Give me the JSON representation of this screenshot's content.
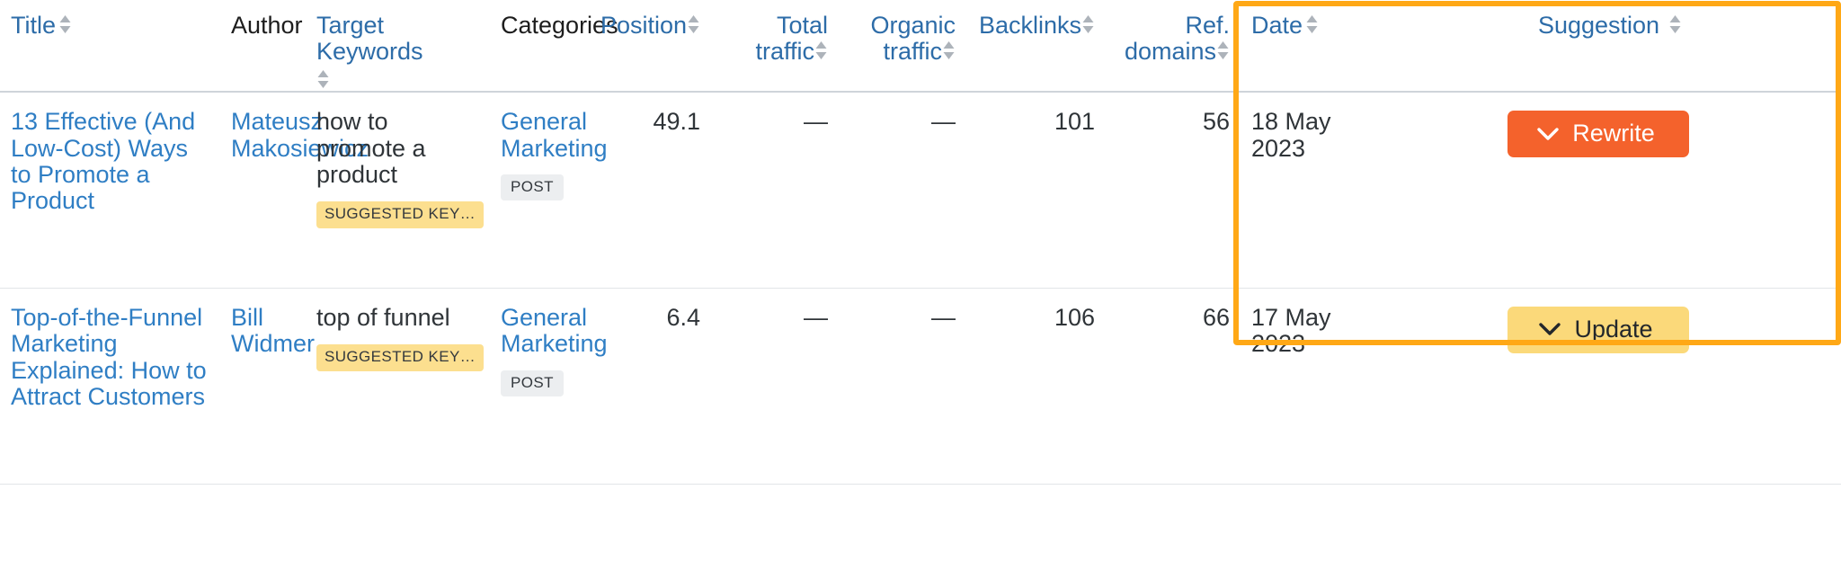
{
  "table": {
    "columns": [
      {
        "id": "title",
        "label": "Title",
        "sortable": true,
        "align": "left",
        "link_style": true
      },
      {
        "id": "author",
        "label": "Author",
        "sortable": false,
        "align": "left",
        "link_style": false
      },
      {
        "id": "target_keywords",
        "label": "Target Keywords",
        "sortable": true,
        "align": "left",
        "link_style": true
      },
      {
        "id": "categories",
        "label": "Categories",
        "sortable": false,
        "align": "left",
        "link_style": false
      },
      {
        "id": "position",
        "label": "Position",
        "sortable": true,
        "align": "right",
        "link_style": true
      },
      {
        "id": "total_traffic",
        "label": "Total traffic",
        "sortable": true,
        "align": "right",
        "link_style": true
      },
      {
        "id": "organic_traffic",
        "label": "Organic traffic",
        "sortable": true,
        "align": "right",
        "link_style": true
      },
      {
        "id": "backlinks",
        "label": "Backlinks",
        "sortable": true,
        "align": "right",
        "link_style": true
      },
      {
        "id": "ref_domains",
        "label": "Ref. domains",
        "sortable": true,
        "align": "right",
        "link_style": true
      },
      {
        "id": "date",
        "label": "Date",
        "sortable": true,
        "align": "left",
        "link_style": true
      },
      {
        "id": "suggestion",
        "label": "Suggestion",
        "sortable": true,
        "align": "center",
        "link_style": true
      }
    ],
    "rows": [
      {
        "title": "13 Effective (And Low-Cost) Ways to Promote a Product",
        "author": "Mateusz Makosiewicz",
        "keyword": "how to promote a product",
        "keyword_badge": "SUGGESTED KEY…",
        "category": "General Marketing",
        "category_badge": "POST",
        "position": "49.1",
        "total_traffic": "—",
        "organic_traffic": "—",
        "backlinks": "101",
        "ref_domains": "56",
        "date": "18 May 2023",
        "suggestion_label": "Rewrite",
        "suggestion_type": "rewrite"
      },
      {
        "title": "Top-of-the-Funnel Marketing Explained: How to Attract Customers",
        "author": "Bill Widmer",
        "keyword": "top of funnel",
        "keyword_badge": "SUGGESTED KEY…",
        "category": "General Marketing",
        "category_badge": "POST",
        "position": "6.4",
        "total_traffic": "—",
        "organic_traffic": "—",
        "backlinks": "106",
        "ref_domains": "66",
        "date": "17 May 2023",
        "suggestion_label": "Update",
        "suggestion_type": "update"
      }
    ]
  },
  "icons": {
    "sort": "sort-arrows-icon",
    "chevron": "chevron-down-icon"
  },
  "colors": {
    "link": "#2f7ec4",
    "header_link": "#2d6ca8",
    "rewrite_button": "#f4622c",
    "update_button": "#fbd97a",
    "keyword_badge": "#fcdf8f",
    "post_badge": "#eceef0",
    "highlight_border": "#ffa816"
  },
  "annotations": {
    "highlight": {
      "name": "suggestion-column-highlight",
      "target_column": "Suggestion"
    }
  }
}
